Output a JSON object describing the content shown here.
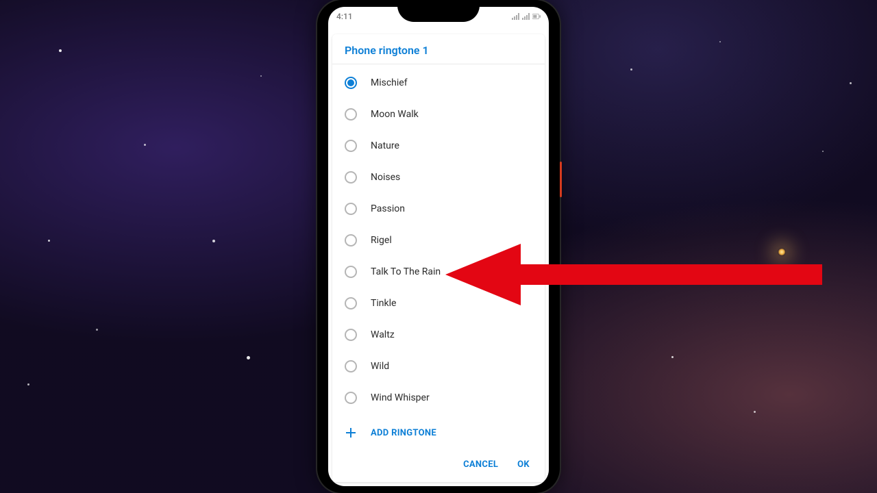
{
  "status": {
    "time": "4:11"
  },
  "dialog": {
    "title": "Phone ringtone 1",
    "selected_index": 0,
    "items": [
      {
        "label": "Mischief"
      },
      {
        "label": "Moon Walk"
      },
      {
        "label": "Nature"
      },
      {
        "label": "Noises"
      },
      {
        "label": "Passion"
      },
      {
        "label": "Rigel"
      },
      {
        "label": "Talk To The Rain"
      },
      {
        "label": "Tinkle"
      },
      {
        "label": "Waltz"
      },
      {
        "label": "Wild"
      },
      {
        "label": "Wind Whisper"
      }
    ],
    "add_label": "ADD RINGTONE",
    "cancel_label": "CANCEL",
    "ok_label": "OK"
  },
  "annotation": {
    "arrow_color": "#e30613",
    "arrow_points_to_index": 6
  }
}
